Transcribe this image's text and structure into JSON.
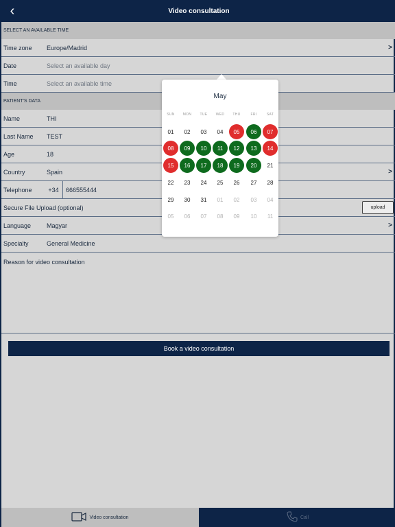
{
  "header": {
    "title": "Video consultation"
  },
  "time_section": {
    "heading": "SELECT AN AVAILABLE TIME",
    "timezone_label": "Time zone",
    "timezone_value": "Europe/Madrid",
    "date_label": "Date",
    "date_placeholder": "Select an available day",
    "time_label": "Time",
    "time_placeholder": "Select an available time"
  },
  "patient_section": {
    "heading": "PATIENT'S DATA",
    "name_label": "Name",
    "name_value": "THI",
    "lastname_label": "Last Name",
    "lastname_value": "TEST",
    "age_label": "Age",
    "age_value": "18",
    "country_label": "Country",
    "country_value": "Spain",
    "telephone_label": "Telephone",
    "telephone_prefix": "+34",
    "telephone_value": "666555444",
    "upload_label": "Secure File Upload (optional)",
    "upload_button": "upload",
    "language_label": "Language",
    "language_value": "Magyar",
    "specialty_label": "Specialty",
    "specialty_value": "General Medicine",
    "reason_label": "Reason for video consultation"
  },
  "book_button": "Book a video consultation",
  "bottom_tabs": {
    "video_label": "Video consultation",
    "call_label": "Call"
  },
  "calendar": {
    "month": "May",
    "weekdays": [
      "SUN",
      "MON",
      "TUE",
      "WED",
      "THU",
      "FRI",
      "SAT"
    ],
    "weeks": [
      [
        {
          "d": "01",
          "s": "normal"
        },
        {
          "d": "02",
          "s": "normal"
        },
        {
          "d": "03",
          "s": "normal"
        },
        {
          "d": "04",
          "s": "normal"
        },
        {
          "d": "05",
          "s": "red"
        },
        {
          "d": "06",
          "s": "green"
        },
        {
          "d": "07",
          "s": "red"
        }
      ],
      [
        {
          "d": "08",
          "s": "red"
        },
        {
          "d": "09",
          "s": "green"
        },
        {
          "d": "10",
          "s": "green"
        },
        {
          "d": "11",
          "s": "green"
        },
        {
          "d": "12",
          "s": "green"
        },
        {
          "d": "13",
          "s": "green"
        },
        {
          "d": "14",
          "s": "red"
        }
      ],
      [
        {
          "d": "15",
          "s": "red"
        },
        {
          "d": "16",
          "s": "green"
        },
        {
          "d": "17",
          "s": "green"
        },
        {
          "d": "18",
          "s": "green"
        },
        {
          "d": "19",
          "s": "green"
        },
        {
          "d": "20",
          "s": "green"
        },
        {
          "d": "21",
          "s": "normal"
        }
      ],
      [
        {
          "d": "22",
          "s": "normal"
        },
        {
          "d": "23",
          "s": "normal"
        },
        {
          "d": "24",
          "s": "normal"
        },
        {
          "d": "25",
          "s": "normal"
        },
        {
          "d": "26",
          "s": "normal"
        },
        {
          "d": "27",
          "s": "normal"
        },
        {
          "d": "28",
          "s": "normal"
        }
      ],
      [
        {
          "d": "29",
          "s": "normal"
        },
        {
          "d": "30",
          "s": "normal"
        },
        {
          "d": "31",
          "s": "normal"
        },
        {
          "d": "01",
          "s": "other"
        },
        {
          "d": "02",
          "s": "other"
        },
        {
          "d": "03",
          "s": "other"
        },
        {
          "d": "04",
          "s": "other"
        }
      ],
      [
        {
          "d": "05",
          "s": "other"
        },
        {
          "d": "06",
          "s": "other"
        },
        {
          "d": "07",
          "s": "other"
        },
        {
          "d": "08",
          "s": "other"
        },
        {
          "d": "09",
          "s": "other"
        },
        {
          "d": "10",
          "s": "other"
        },
        {
          "d": "11",
          "s": "other"
        }
      ]
    ]
  },
  "colors": {
    "navy": "#0d2447",
    "available_day": "#0e6b1e",
    "unavailable_day": "#e02d2d"
  },
  "icons": {
    "back": "chevron-left-icon",
    "video": "video-camera-icon",
    "call": "phone-icon",
    "disclosure": "chevron-right-icon"
  }
}
